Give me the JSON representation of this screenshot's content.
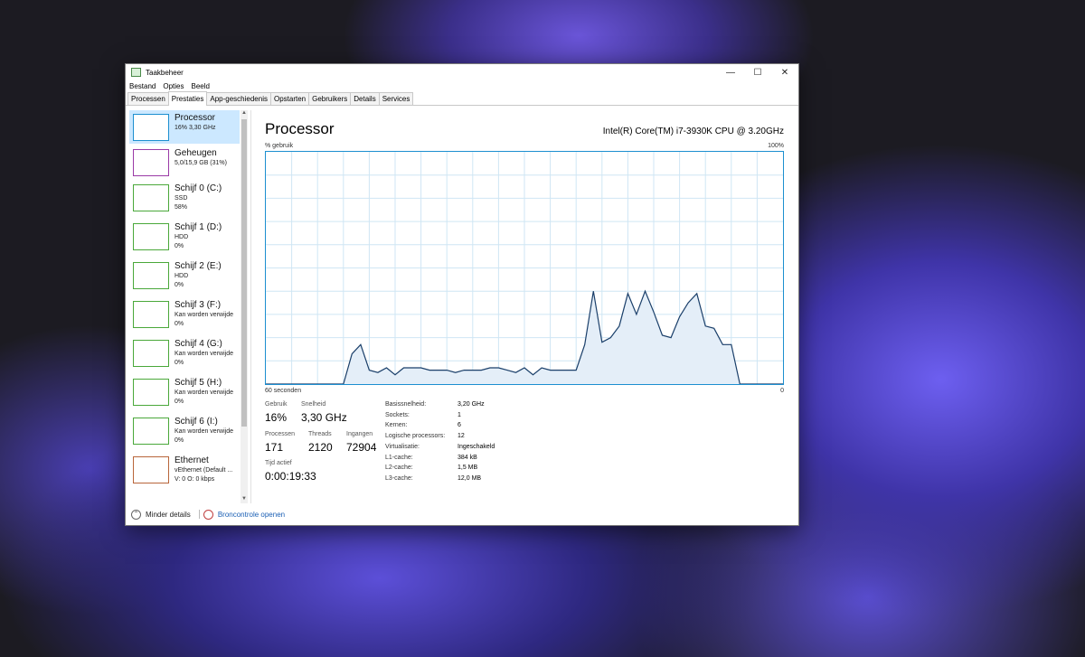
{
  "window": {
    "title": "Taakbeheer",
    "controls": {
      "minimize": "—",
      "maximize": "☐",
      "close": "✕"
    }
  },
  "menu": [
    "Bestand",
    "Opties",
    "Beeld"
  ],
  "tabs": [
    "Processen",
    "Prestaties",
    "App-geschiedenis",
    "Opstarten",
    "Gebruikers",
    "Details",
    "Services"
  ],
  "active_tab": "Prestaties",
  "sidebar": {
    "items": [
      {
        "title": "Processor",
        "lines": [
          "16% 3,30 GHz"
        ],
        "color": "#1c8fd0",
        "selected": true
      },
      {
        "title": "Geheugen",
        "lines": [
          "5,0/15,9 GB (31%)"
        ],
        "color": "#9a3aa6",
        "selected": false
      },
      {
        "title": "Schijf 0 (C:)",
        "lines": [
          "SSD",
          "58%"
        ],
        "color": "#4aa83a",
        "selected": false
      },
      {
        "title": "Schijf 1 (D:)",
        "lines": [
          "HDD",
          "0%"
        ],
        "color": "#4aa83a",
        "selected": false
      },
      {
        "title": "Schijf 2 (E:)",
        "lines": [
          "HDD",
          "0%"
        ],
        "color": "#4aa83a",
        "selected": false
      },
      {
        "title": "Schijf 3 (F:)",
        "lines": [
          "Kan worden verwijde",
          "0%"
        ],
        "color": "#4aa83a",
        "selected": false
      },
      {
        "title": "Schijf 4 (G:)",
        "lines": [
          "Kan worden verwijde",
          "0%"
        ],
        "color": "#4aa83a",
        "selected": false
      },
      {
        "title": "Schijf 5 (H:)",
        "lines": [
          "Kan worden verwijde",
          "0%"
        ],
        "color": "#4aa83a",
        "selected": false
      },
      {
        "title": "Schijf 6 (I:)",
        "lines": [
          "Kan worden verwijde",
          "0%"
        ],
        "color": "#4aa83a",
        "selected": false
      },
      {
        "title": "Ethernet",
        "lines": [
          "vEthernet (Default ...",
          "V: 0 O: 0 kbps"
        ],
        "color": "#b8653a",
        "selected": false
      }
    ],
    "scroll_up": "▲",
    "scroll_down": "▼"
  },
  "main": {
    "title": "Processor",
    "cpu_model": "Intel(R) Core(TM) i7-3930K CPU @ 3.20GHz",
    "axis": {
      "top_left": "% gebruik",
      "top_right": "100%",
      "bottom_left": "60 seconden",
      "bottom_right": "0"
    },
    "stats": {
      "usage_label": "Gebruik",
      "usage_value": "16%",
      "speed_label": "Snelheid",
      "speed_value": "3,30 GHz",
      "processes_label": "Processen",
      "processes_value": "171",
      "threads_label": "Threads",
      "threads_value": "2120",
      "handles_label": "Ingangen",
      "handles_value": "72904",
      "uptime_label": "Tijd actief",
      "uptime_value": "0:00:19:33"
    },
    "info": [
      {
        "label": "Basissnelheid:",
        "value": "3,20 GHz"
      },
      {
        "label": "Sockets:",
        "value": "1"
      },
      {
        "label": "Kernen:",
        "value": "6"
      },
      {
        "label": "Logische processors:",
        "value": "12"
      },
      {
        "label": "Virtualisatie:",
        "value": "Ingeschakeld"
      },
      {
        "label": "L1-cache:",
        "value": "384 kB"
      },
      {
        "label": "L2-cache:",
        "value": "1,5 MB"
      },
      {
        "label": "L3-cache:",
        "value": "12,0 MB"
      }
    ]
  },
  "footer": {
    "fewer_details": "Minder details",
    "resource_monitor": "Broncontrole openen"
  },
  "chart_data": {
    "type": "area",
    "x": [
      60,
      58,
      57,
      56,
      55,
      54,
      53,
      52,
      51,
      50,
      49,
      48,
      47,
      46,
      45,
      44,
      43,
      42,
      41,
      40,
      39,
      38,
      37,
      36,
      35,
      34,
      33,
      32,
      31,
      30,
      29,
      28,
      27,
      26,
      25,
      24,
      23,
      22,
      21,
      20,
      19,
      18,
      17,
      16,
      15,
      14,
      13,
      12,
      11,
      10,
      9,
      8,
      7,
      6,
      5,
      4,
      3,
      2,
      1,
      0
    ],
    "values": [
      0,
      0,
      0,
      0,
      0,
      0,
      0,
      0,
      0,
      13,
      17,
      6,
      5,
      7,
      4,
      7,
      7,
      7,
      6,
      6,
      6,
      5,
      6,
      6,
      6,
      7,
      7,
      6,
      5,
      7,
      4,
      7,
      6,
      6,
      6,
      6,
      17,
      40,
      18,
      20,
      25,
      39,
      30,
      40,
      31,
      21,
      20,
      29,
      35,
      39,
      25,
      24,
      17,
      17,
      0,
      0,
      0,
      0,
      0,
      0
    ],
    "ylim": [
      0,
      100
    ],
    "line_color": "#1a3f6a",
    "fill_color": "#e4eef8",
    "grid_color": "#cfe6f4"
  }
}
